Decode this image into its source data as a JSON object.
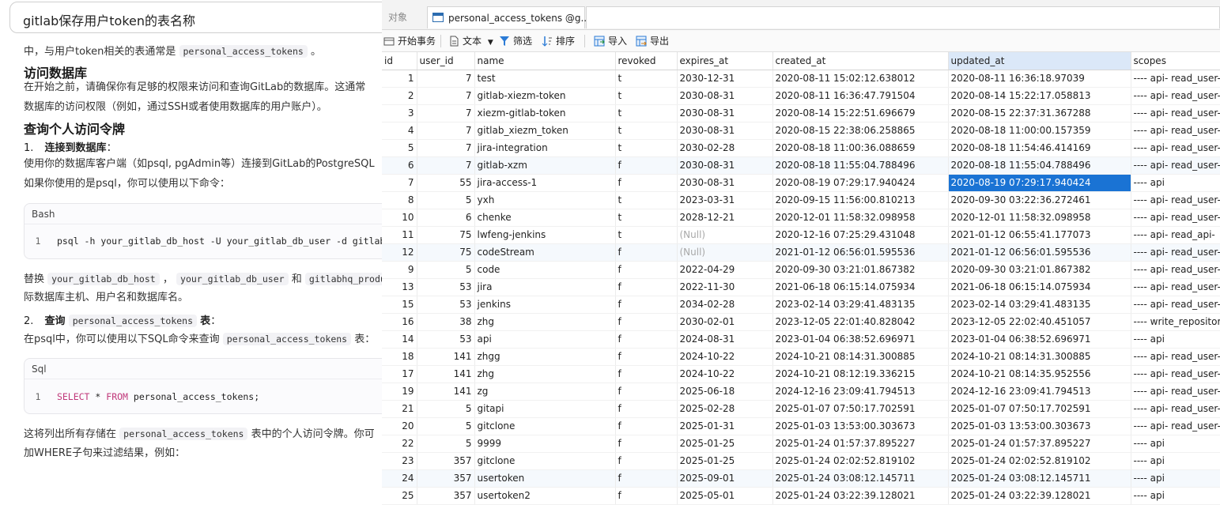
{
  "left": {
    "query": "gitlab保存用户token的表名称",
    "intro_prefix": "中，与用户token相关的表通常是",
    "intro_code": "personal_access_tokens",
    "intro_suffix": "。",
    "h_access": "访问数据库",
    "p_access_1": "在开始之前，请确保你有足够的权限来访问和查询GitLab的数据库。这通常",
    "p_access_2": "数据库的访问权限（例如，通过SSH或者使用数据库的用户账户）。",
    "h_query": "查询个人访问令牌",
    "step1_num": "1.",
    "step1_label": "连接到数据库",
    "step1_colon": "：",
    "p_connect": "使用你的数据库客户端（如psql, pgAdmin等）连接到GitLab的PostgreSQL",
    "p_psql": "如果你使用的是psql，你可以使用以下命令：",
    "bash_lang": "Bash",
    "bash_ln": "1",
    "bash_code": "psql -h your_gitlab_db_host -U your_gitlab_db_user -d gitlabhq_production",
    "replace_word": "替换",
    "replace_c1": "your_gitlab_db_host",
    "replace_sep": "，",
    "replace_c2": "your_gitlab_db_user",
    "replace_and": "和",
    "replace_c3": "gitlabhq_production",
    "p_replace_2": "际数据库主机、用户名和数据库名。",
    "step2_num": "2.",
    "step2_label": "查询",
    "step2_code": "personal_access_tokens",
    "step2_label2": "表",
    "step2_colon": "：",
    "p_sql_prefix": "在psql中，你可以使用以下SQL命令来查询",
    "p_sql_code": "personal_access_tokens",
    "p_sql_suffix": "表：",
    "sql_lang": "Sql",
    "sql_ln": "1",
    "sql_kw1": "SELECT",
    "sql_mid": " * ",
    "sql_kw2": "FROM",
    "sql_rest": " personal_access_tokens;",
    "p_list_prefix": "这将列出所有存储在",
    "p_list_code": "personal_access_tokens",
    "p_list_suffix": "表中的个人访问令牌。你可",
    "p_where": "加WHERE子句来过滤结果，例如："
  },
  "right": {
    "tab_objects": "对象",
    "tab_table": "personal_access_tokens @g...",
    "toolbar": {
      "begin_tx": "开始事务",
      "text": "文本",
      "filter": "筛选",
      "sort": "排序",
      "import": "导入",
      "export": "导出"
    },
    "columns": [
      "id",
      "user_id",
      "name",
      "revoked",
      "expires_at",
      "created_at",
      "updated_at",
      "scopes"
    ],
    "rows": [
      [
        "1",
        "7",
        "test",
        "t",
        "2030-12-31",
        "2020-08-11 15:02:12.638012",
        "2020-08-11 16:36:18.97039",
        "---- api- read_user-"
      ],
      [
        "2",
        "7",
        "gitlab-xiezm-token",
        "t",
        "2030-08-31",
        "2020-08-11 16:36:47.791504",
        "2020-08-14 15:22:17.058813",
        "---- api- read_user-"
      ],
      [
        "3",
        "7",
        "xiezm-gitlab-token",
        "t",
        "2030-08-31",
        "2020-08-14 15:22:51.696679",
        "2020-08-15 22:37:31.367288",
        "---- api- read_user-"
      ],
      [
        "4",
        "7",
        "gitlab_xiezm_token",
        "t",
        "2030-08-31",
        "2020-08-15 22:38:06.258865",
        "2020-08-18 11:00:00.157359",
        "---- api- read_user-"
      ],
      [
        "5",
        "7",
        "jira-integration",
        "t",
        "2030-02-28",
        "2020-08-18 11:00:36.088659",
        "2020-08-18 11:54:46.414169",
        "---- api- read_user-"
      ],
      [
        "6",
        "7",
        "gitlab-xzm",
        "f",
        "2030-08-31",
        "2020-08-18 11:55:04.788496",
        "2020-08-18 11:55:04.788496",
        "---- api- read_user-"
      ],
      [
        "7",
        "55",
        "jira-access-1",
        "f",
        "2030-08-31",
        "2020-08-19 07:29:17.940424",
        "2020-08-19 07:29:17.940424",
        "---- api"
      ],
      [
        "8",
        "5",
        "yxh",
        "t",
        "2023-03-31",
        "2020-09-15 11:56:00.810213",
        "2020-09-30 03:22:36.272461",
        "---- api- read_user-"
      ],
      [
        "10",
        "6",
        "chenke",
        "t",
        "2028-12-21",
        "2020-12-01 11:58:32.098958",
        "2020-12-01 11:58:32.098958",
        "---- api- read_user-"
      ],
      [
        "11",
        "75",
        "lwfeng-jenkins",
        "t",
        "(Null)",
        "2020-12-16 07:25:29.431048",
        "2021-01-12 06:55:41.177073",
        "---- api- read_api-"
      ],
      [
        "12",
        "75",
        "codeStream",
        "f",
        "(Null)",
        "2021-01-12 06:56:01.595536",
        "2021-01-12 06:56:01.595536",
        "---- api- read_user-"
      ],
      [
        "9",
        "5",
        "code",
        "f",
        "2022-04-29",
        "2020-09-30 03:21:01.867382",
        "2020-09-30 03:21:01.867382",
        "---- api- read_user-"
      ],
      [
        "13",
        "53",
        "jira",
        "f",
        "2022-11-30",
        "2021-06-18 06:15:14.075934",
        "2021-06-18 06:15:14.075934",
        "---- api- read_user-"
      ],
      [
        "15",
        "53",
        "jenkins",
        "f",
        "2034-02-28",
        "2023-02-14 03:29:41.483135",
        "2023-02-14 03:29:41.483135",
        "---- api- read_user-"
      ],
      [
        "16",
        "38",
        "zhg",
        "f",
        "2030-02-01",
        "2023-12-05 22:01:40.828042",
        "2023-12-05 22:02:40.451057",
        "---- write_repositor"
      ],
      [
        "14",
        "53",
        "api",
        "f",
        "2024-08-31",
        "2023-01-04 06:38:52.696971",
        "2023-01-04 06:38:52.696971",
        "---- api"
      ],
      [
        "18",
        "141",
        "zhgg",
        "f",
        "2024-10-22",
        "2024-10-21 08:14:31.300885",
        "2024-10-21 08:14:31.300885",
        "---- api- read_user-"
      ],
      [
        "17",
        "141",
        "zhg",
        "f",
        "2024-10-22",
        "2024-10-21 08:12:19.336215",
        "2024-10-21 08:14:35.952556",
        "---- api- read_user-"
      ],
      [
        "19",
        "141",
        "zg",
        "f",
        "2025-06-18",
        "2024-12-16 23:09:41.794513",
        "2024-12-16 23:09:41.794513",
        "---- api- read_user-"
      ],
      [
        "21",
        "5",
        "gitapi",
        "f",
        "2025-02-28",
        "2025-01-07 07:50:17.702591",
        "2025-01-07 07:50:17.702591",
        "---- api- read_user-"
      ],
      [
        "20",
        "5",
        "gitclone",
        "f",
        "2025-01-31",
        "2025-01-03 13:53:00.303673",
        "2025-01-03 13:53:00.303673",
        "---- api- read_user-"
      ],
      [
        "22",
        "5",
        "9999",
        "f",
        "2025-01-25",
        "2025-01-24 01:57:37.895227",
        "2025-01-24 01:57:37.895227",
        "---- api"
      ],
      [
        "23",
        "357",
        "gitclone",
        "f",
        "2025-01-25",
        "2025-01-24 02:02:52.819102",
        "2025-01-24 02:02:52.819102",
        "---- api"
      ],
      [
        "24",
        "357",
        "usertoken",
        "f",
        "2025-09-01",
        "2025-01-24 03:08:12.145711",
        "2025-01-24 03:08:12.145711",
        "---- api"
      ],
      [
        "25",
        "357",
        "usertoken2",
        "f",
        "2025-05-01",
        "2025-01-24 03:22:39.128021",
        "2025-01-24 03:22:39.128021",
        "---- api"
      ]
    ],
    "alt_rows": [
      5,
      10,
      23
    ],
    "selected_column": "updated_at",
    "selected_cell": {
      "row": 6,
      "col": 6
    },
    "colors": {
      "selection": "#1a73d4",
      "header_selected": "#dbe8f8",
      "null_text": "#a8a8a8"
    }
  }
}
